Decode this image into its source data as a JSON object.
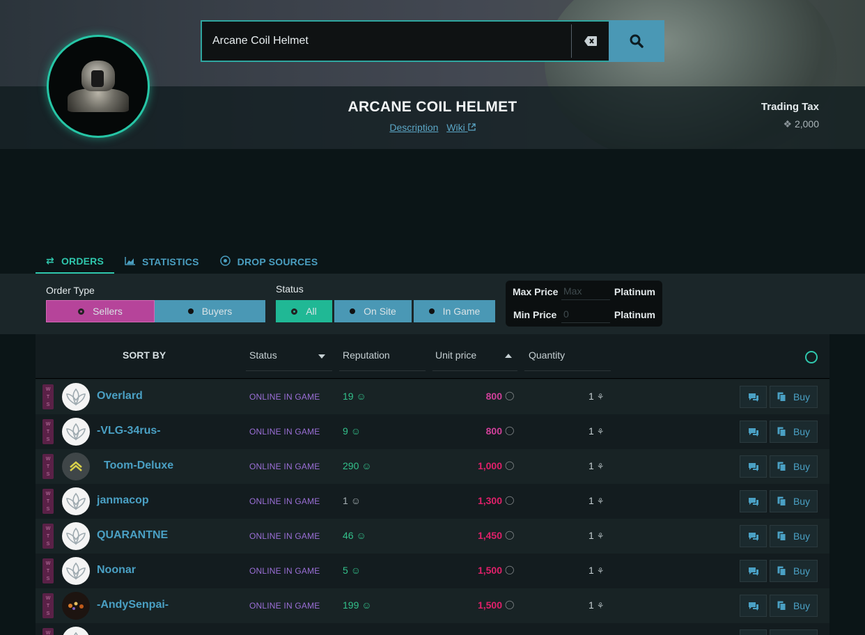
{
  "search": {
    "value": "Arcane Coil Helmet"
  },
  "item": {
    "title": "ARCANE COIL HELMET",
    "description_link": "Description",
    "wiki_link": "Wiki"
  },
  "tax": {
    "label": "Trading Tax",
    "value": "2,000"
  },
  "tabs": [
    {
      "label": "ORDERS",
      "icon": "swap-arrows-icon",
      "active": true
    },
    {
      "label": "STATISTICS",
      "icon": "area-chart-icon",
      "active": false
    },
    {
      "label": "DROP SOURCES",
      "icon": "drop-sources-icon",
      "active": false
    }
  ],
  "filters": {
    "order_type_label": "Order Type",
    "sellers": "Sellers",
    "buyers": "Buyers",
    "status_label": "Status",
    "status_all": "All",
    "status_onsite": "On Site",
    "status_ingame": "In Game",
    "max_price_label": "Max Price",
    "max_price_placeholder": "Max",
    "min_price_label": "Min Price",
    "min_price_value": "0",
    "platinum": "Platinum"
  },
  "table": {
    "sort_by": "SORT BY",
    "col_status": "Status",
    "col_reputation": "Reputation",
    "col_unit_price": "Unit price",
    "col_quantity": "Quantity",
    "buy_label": "Buy",
    "rows": [
      {
        "type": "WTS",
        "user": "Overlard",
        "status": "ONLINE IN GAME",
        "reputation": "19",
        "price": "800",
        "quantity": "1",
        "price_color": "#d0409a"
      },
      {
        "type": "WTS",
        "user": "-VLG-34rus-",
        "status": "ONLINE IN GAME",
        "reputation": "9",
        "price": "800",
        "quantity": "1",
        "price_color": "#d0409a"
      },
      {
        "type": "WTS",
        "user": "Toom-Deluxe",
        "status": "ONLINE IN GAME",
        "reputation": "290",
        "price": "1,000",
        "quantity": "1",
        "price_color": "#e0206a"
      },
      {
        "type": "WTS",
        "user": "janmacop",
        "status": "ONLINE IN GAME",
        "reputation": "1",
        "price": "1,300",
        "quantity": "1",
        "price_color": "#e0206a"
      },
      {
        "type": "WTS",
        "user": "QUARANTNE",
        "status": "ONLINE IN GAME",
        "reputation": "46",
        "price": "1,450",
        "quantity": "1",
        "price_color": "#e0206a"
      },
      {
        "type": "WTS",
        "user": "Noonar",
        "status": "ONLINE IN GAME",
        "reputation": "5",
        "price": "1,500",
        "quantity": "1",
        "price_color": "#e0206a"
      },
      {
        "type": "WTS",
        "user": "-AndySenpai-",
        "status": "ONLINE IN GAME",
        "reputation": "199",
        "price": "1,500",
        "quantity": "1",
        "price_color": "#e0206a"
      }
    ]
  }
}
